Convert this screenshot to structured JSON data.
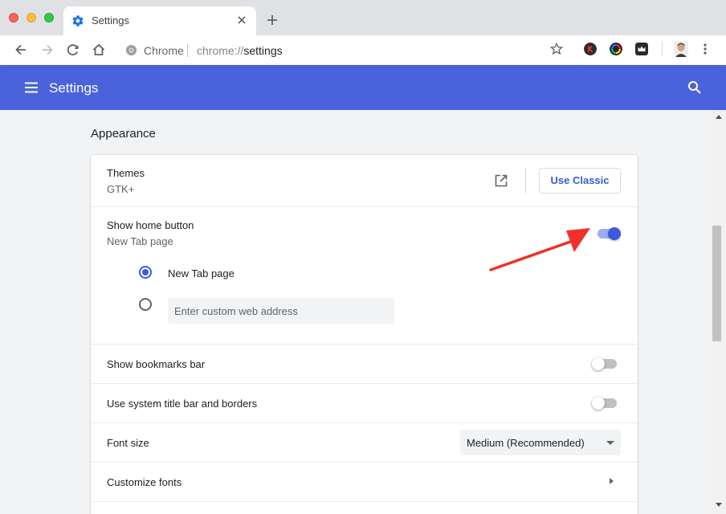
{
  "browser": {
    "tab_title": "Settings",
    "omnibox": {
      "chip": "Chrome",
      "url_scheme": "chrome://",
      "url_host": "settings"
    },
    "extensions": [
      "k-extension-icon",
      "color-wheel-extension-icon",
      "crown-extension-icon"
    ]
  },
  "header": {
    "title": "Settings",
    "color": "#4a63dd"
  },
  "appearance": {
    "section_title": "Appearance",
    "themes": {
      "label": "Themes",
      "value": "GTK+",
      "button_label": "Use Classic"
    },
    "home_button": {
      "label": "Show home button",
      "value": "New Tab page",
      "enabled": true,
      "options": {
        "new_tab_label": "New Tab page",
        "custom_placeholder": "Enter custom web address"
      }
    },
    "bookmarks_bar": {
      "label": "Show bookmarks bar",
      "enabled": false
    },
    "system_title_bar": {
      "label": "Use system title bar and borders",
      "enabled": false
    },
    "font_size": {
      "label": "Font size",
      "selected": "Medium (Recommended)"
    },
    "customize_fonts": {
      "label": "Customize fonts"
    }
  },
  "colors": {
    "accent": "#3d5ade",
    "annotation_arrow": "#f0302a"
  }
}
